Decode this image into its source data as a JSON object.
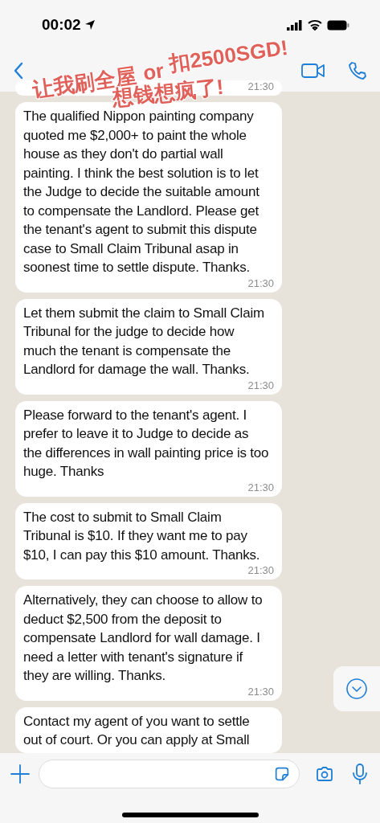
{
  "status_bar": {
    "time": "00:02"
  },
  "messages": [
    {
      "time": "21:30"
    },
    {
      "text": "The qualified Nippon painting company quoted me $2,000+ to paint the whole house as they don't do partial wall painting. I think the best solution is to let the Judge to decide the suitable amount to compensate the Landlord. Please get the tenant's agent to submit this dispute case to Small Claim Tribunal asap in soonest time to settle dispute. Thanks.",
      "time": "21:30"
    },
    {
      "text": "Let them submit the claim to Small Claim Tribunal for the judge to decide how much the tenant is compensate the Landlord for damage the wall. Thanks.",
      "time": "21:30"
    },
    {
      "text": "Please forward to the tenant's agent. I prefer to leave it to Judge to decide as the differences in wall painting price is too huge. Thanks",
      "time": "21:30"
    },
    {
      "text": "The cost to submit to Small Claim Tribunal is $10. If they want me to pay $10, I can pay this $10 amount. Thanks.",
      "time": "21:30"
    },
    {
      "text": "Alternatively, they can choose to allow to deduct $2,500 from the deposit to compensate Landlord for wall damage. I need a letter with tenant's signature if they are willing. Thanks.",
      "time": "21:30"
    },
    {
      "text": "Contact my agent of you want to settle out of court. Or you can apply at Small"
    }
  ],
  "caption": [
    "让我刷全屋",
    "or",
    "扣2500SGD!",
    "想钱想疯了!"
  ]
}
